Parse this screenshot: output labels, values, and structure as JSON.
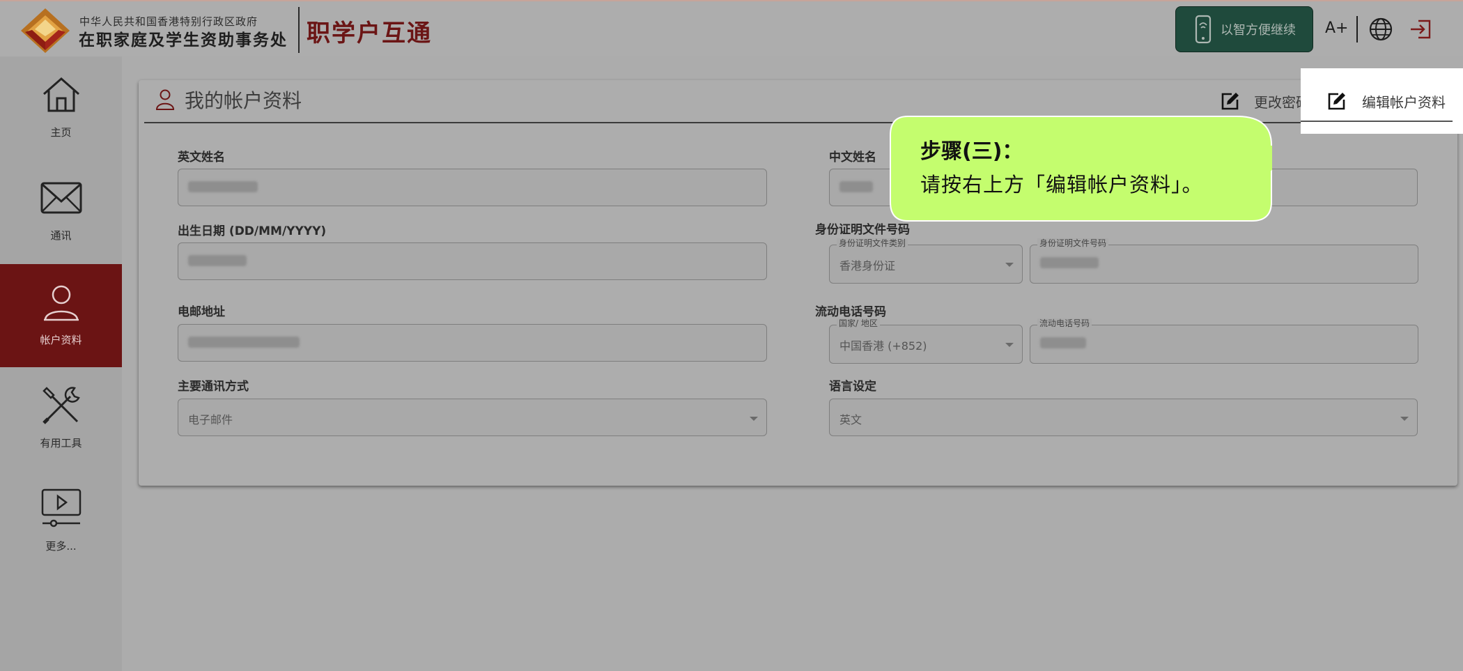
{
  "header": {
    "gov_line": "中华人民共和国香港特别行政区政府",
    "office_line": "在职家庭及学生资助事务处",
    "brand": "职学户互通",
    "smart_button": "以智方便继续",
    "font_size": "A+",
    "icons": {
      "language": "globe-icon",
      "logout": "logout-icon",
      "smart": "smartphone-icon"
    }
  },
  "sidebar": {
    "items": [
      {
        "label": "主页",
        "icon": "home-icon",
        "active": false
      },
      {
        "label": "通讯",
        "icon": "mail-icon",
        "active": false
      },
      {
        "label": "帐户资料",
        "icon": "user-icon",
        "active": true
      },
      {
        "label": "有用工具",
        "icon": "tools-icon",
        "active": false
      },
      {
        "label": "更多...",
        "icon": "video-icon",
        "active": false
      }
    ]
  },
  "card": {
    "title": "我的帐户资料",
    "change_password": "更改密码",
    "edit_profile": "编辑帐户资料",
    "fields": {
      "english_name": {
        "label": "英文姓名",
        "value": "•••• ••••••"
      },
      "chinese_name": {
        "label": "中文姓名",
        "value": "•••"
      },
      "dob": {
        "label": "出生日期 (DD/MM/YYYY)",
        "value": "••/••/••••"
      },
      "id_doc": {
        "label": "身份证明文件号码",
        "type_legend": "身份证明文件类别",
        "type_value": "香港身份证",
        "number_legend": "身份证明文件号码",
        "number_value": "•••••••"
      },
      "email": {
        "label": "电邮地址",
        "value": "••••••@••••••.••••"
      },
      "mobile": {
        "label": "流动电话号码",
        "region_legend": "国家/ 地区",
        "region_value": "中国香港 (+852)",
        "number_legend": "流动电话号码",
        "number_value": "••••••••"
      },
      "contact_method": {
        "label": "主要通讯方式",
        "value": "电子邮件"
      },
      "language": {
        "label": "语言设定",
        "value": "英文"
      }
    }
  },
  "callout": {
    "step": "步骤(三)：",
    "text": "请按右上方「编辑帐户资料」。",
    "color": "#c4fd6e"
  },
  "colors": {
    "brand": "#6b1515",
    "active_nav": "#6b1414",
    "smart_button": "#1f4a3c"
  }
}
